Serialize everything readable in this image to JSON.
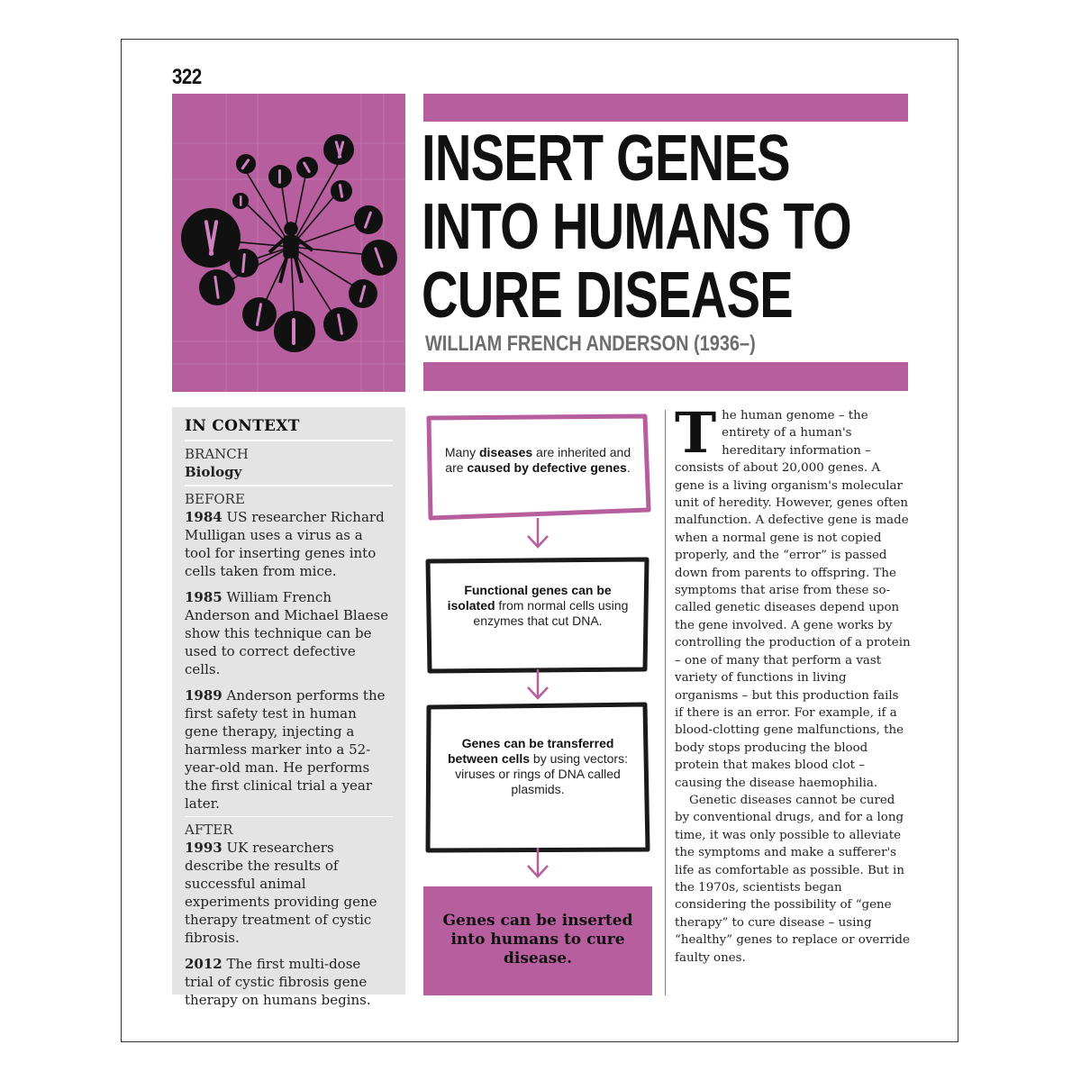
{
  "page_number": "322",
  "headline": {
    "line1": "INSERT GENES",
    "line2": "INTO HUMANS TO",
    "line3": "CURE DISEASE"
  },
  "byline": "WILLIAM FRENCH ANDERSON (1936–)",
  "in_context": {
    "heading": "IN CONTEXT",
    "branch_label": "BRANCH",
    "branch_value": "Biology",
    "before_label": "BEFORE",
    "before_entries": [
      {
        "year": "1984",
        "text": " US researcher Richard Mulligan uses a virus as a tool for inserting genes into cells taken from mice."
      },
      {
        "year": "1985",
        "text": " William French Anderson and Michael Blaese show this technique can be used to correct defective cells."
      },
      {
        "year": "1989",
        "text": " Anderson performs the first safety test in human gene therapy, injecting a harmless marker into a 52-year-old man. He performs the first clinical trial a year later."
      }
    ],
    "after_label": "AFTER",
    "after_entries": [
      {
        "year": "1993",
        "text": " UK researchers describe the results of successful animal experiments providing gene therapy treatment of cystic fibrosis."
      },
      {
        "year": "2012",
        "text": " The first multi-dose trial of cystic fibrosis gene therapy on humans begins."
      }
    ]
  },
  "flowchart": {
    "box1": {
      "pre": "Many ",
      "bold1": "diseases",
      "mid": " are inherited and are ",
      "bold2": "caused by defective genes",
      "post": "."
    },
    "box2": {
      "bold": "Functional genes can be isolated",
      "rest": " from normal cells using enzymes that cut DNA."
    },
    "box3": {
      "bold": "Genes can be transferred between cells",
      "rest": " by using vectors: viruses or rings of DNA called plasmids."
    },
    "conclusion": "Genes can be inserted into humans to cure disease."
  },
  "body": {
    "dropcap": "T",
    "para1": "he human genome – the entirety of a human's hereditary information – consists of about 20,000 genes. A gene is a living organism's molecular unit of heredity. However, genes often malfunction. A defective gene is made when a normal gene is not copied properly, and the “error” is passed down from parents to offspring. The symptoms that arise from these so-called genetic diseases depend upon the gene involved. A gene works by controlling the production of a protein – one of many that perform a vast variety of functions in living organisms – but this production fails if there is an error. For example, if a blood-clotting gene malfunctions, the body stops producing the blood protein that makes blood clot – causing the disease haemophilia.",
    "para2": "Genetic diseases cannot be cured by conventional drugs, and for a long time, it was only possible to alleviate the symptoms and make a sufferer's life as comfortable as possible. But in the 1970s, scientists began considering the possibility of “gene therapy” to cure disease – using “healthy” genes to replace or override faulty ones."
  },
  "colors": {
    "accent": "#b65e9e",
    "sidebar": "#e4e4e4",
    "byline": "#6d6d6d"
  },
  "icons": [
    "human-figure-icon",
    "chromosome-icon",
    "down-arrow-icon"
  ]
}
